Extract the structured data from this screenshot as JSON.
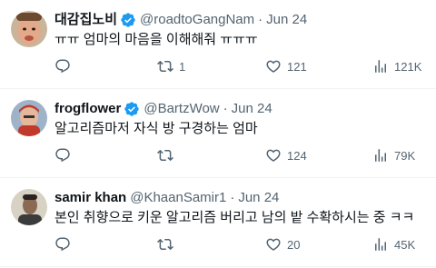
{
  "colors": {
    "verified": "#1d9bf0",
    "muted": "#536471",
    "text": "#0f1419",
    "divider": "#eff3f4"
  },
  "tweets": [
    {
      "name": "대감집노비",
      "handle": "@roadtoGangNam",
      "separator": "·",
      "date": "Jun 24",
      "verified": true,
      "text": "ㅠㅠ 엄마의 마음을 이해해줘 ㅠㅠㅠ",
      "replies": "",
      "retweets": "1",
      "likes": "121",
      "views": "121K",
      "avatar_icon": "user-avatar-photo"
    },
    {
      "name": "frogflower",
      "handle": "@BartzWow",
      "separator": "·",
      "date": "Jun 24",
      "verified": true,
      "text": "알고리즘마저 자식 방 구경하는 엄마",
      "replies": "",
      "retweets": "",
      "likes": "124",
      "views": "79K",
      "avatar_icon": "user-avatar-photo"
    },
    {
      "name": "samir khan",
      "handle": "@KhaanSamir1",
      "separator": "·",
      "date": "Jun 24",
      "verified": false,
      "text": "본인 취향으로 키운 알고리즘 버리고 남의 밭 수확하시는 중 ㅋㅋ",
      "replies": "",
      "retweets": "",
      "likes": "20",
      "views": "45K",
      "avatar_icon": "user-avatar-photo"
    }
  ],
  "icons": {
    "reply": "reply-icon",
    "retweet": "retweet-icon",
    "like": "heart-icon",
    "views": "views-chart-icon",
    "verified": "verified-badge-icon"
  }
}
